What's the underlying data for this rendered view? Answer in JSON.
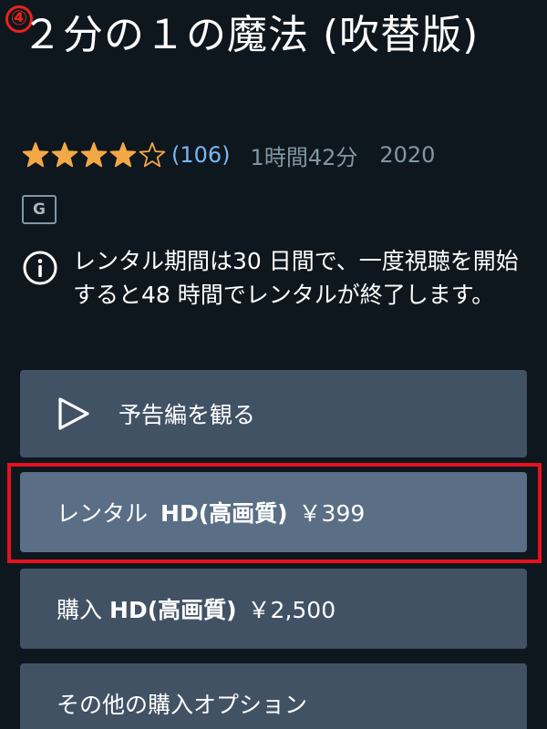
{
  "annotation": {
    "step_number": "④",
    "highlight_color": "#e8101e"
  },
  "title": {
    "text": "２分の１の魔法 (吹替版)"
  },
  "meta": {
    "rating_value": 4,
    "rating_max": 5,
    "review_count": "(106)",
    "duration": "1時間42分",
    "year": "2020",
    "star_color": "#f3a847"
  },
  "content_rating": "G",
  "notice": {
    "icon": "info-icon",
    "text": "レンタル期間は30 日間で、一度視聴を開始すると48 時間でレンタルが終了します。"
  },
  "buttons": {
    "trailer": {
      "icon": "play-icon",
      "label": "予告編を観る"
    },
    "rent": {
      "label": "レンタル",
      "quality": "HD(高画質)",
      "price": "￥399"
    },
    "buy": {
      "label": "購入",
      "quality": "HD(高画質)",
      "price": "￥2,500"
    },
    "more": {
      "label": "その他の購入オプション"
    }
  },
  "colors": {
    "background": "#0f171e",
    "button": "#425265",
    "button_selected": "#5a6e86",
    "link": "#79b8f3",
    "muted": "#8197a4"
  }
}
